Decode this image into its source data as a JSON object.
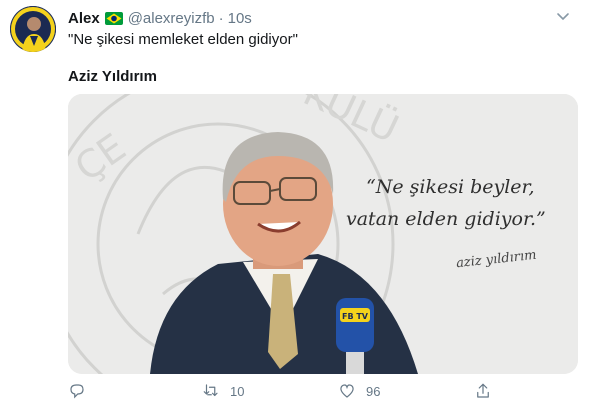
{
  "tweet": {
    "author_name": "Alex",
    "handle": "@alexreyizfb",
    "separator": "·",
    "time": "10s",
    "text": "\"Ne şikesi memleket elden gidiyor\"",
    "subheading": "Aziz Yıldırım"
  },
  "media": {
    "quote_line1": "“Ne şikesi beyler,",
    "quote_line2": "vatan elden gidiyor.”",
    "signature": "aziz yıldırım",
    "mic_flag_text": "FB TV",
    "background_seal_text": "FENERBAHÇE SPOR KULÜBÜ"
  },
  "actions": {
    "reply_count": "",
    "retweet_count": "10",
    "like_count": "96"
  },
  "colors": {
    "text": "#14171a",
    "muted": "#657786",
    "media_bg": "#e9e9e8"
  },
  "icons": [
    "avatar",
    "brazil-flag-icon",
    "chevron-down-icon",
    "reply-icon",
    "retweet-icon",
    "like-icon",
    "share-icon"
  ]
}
